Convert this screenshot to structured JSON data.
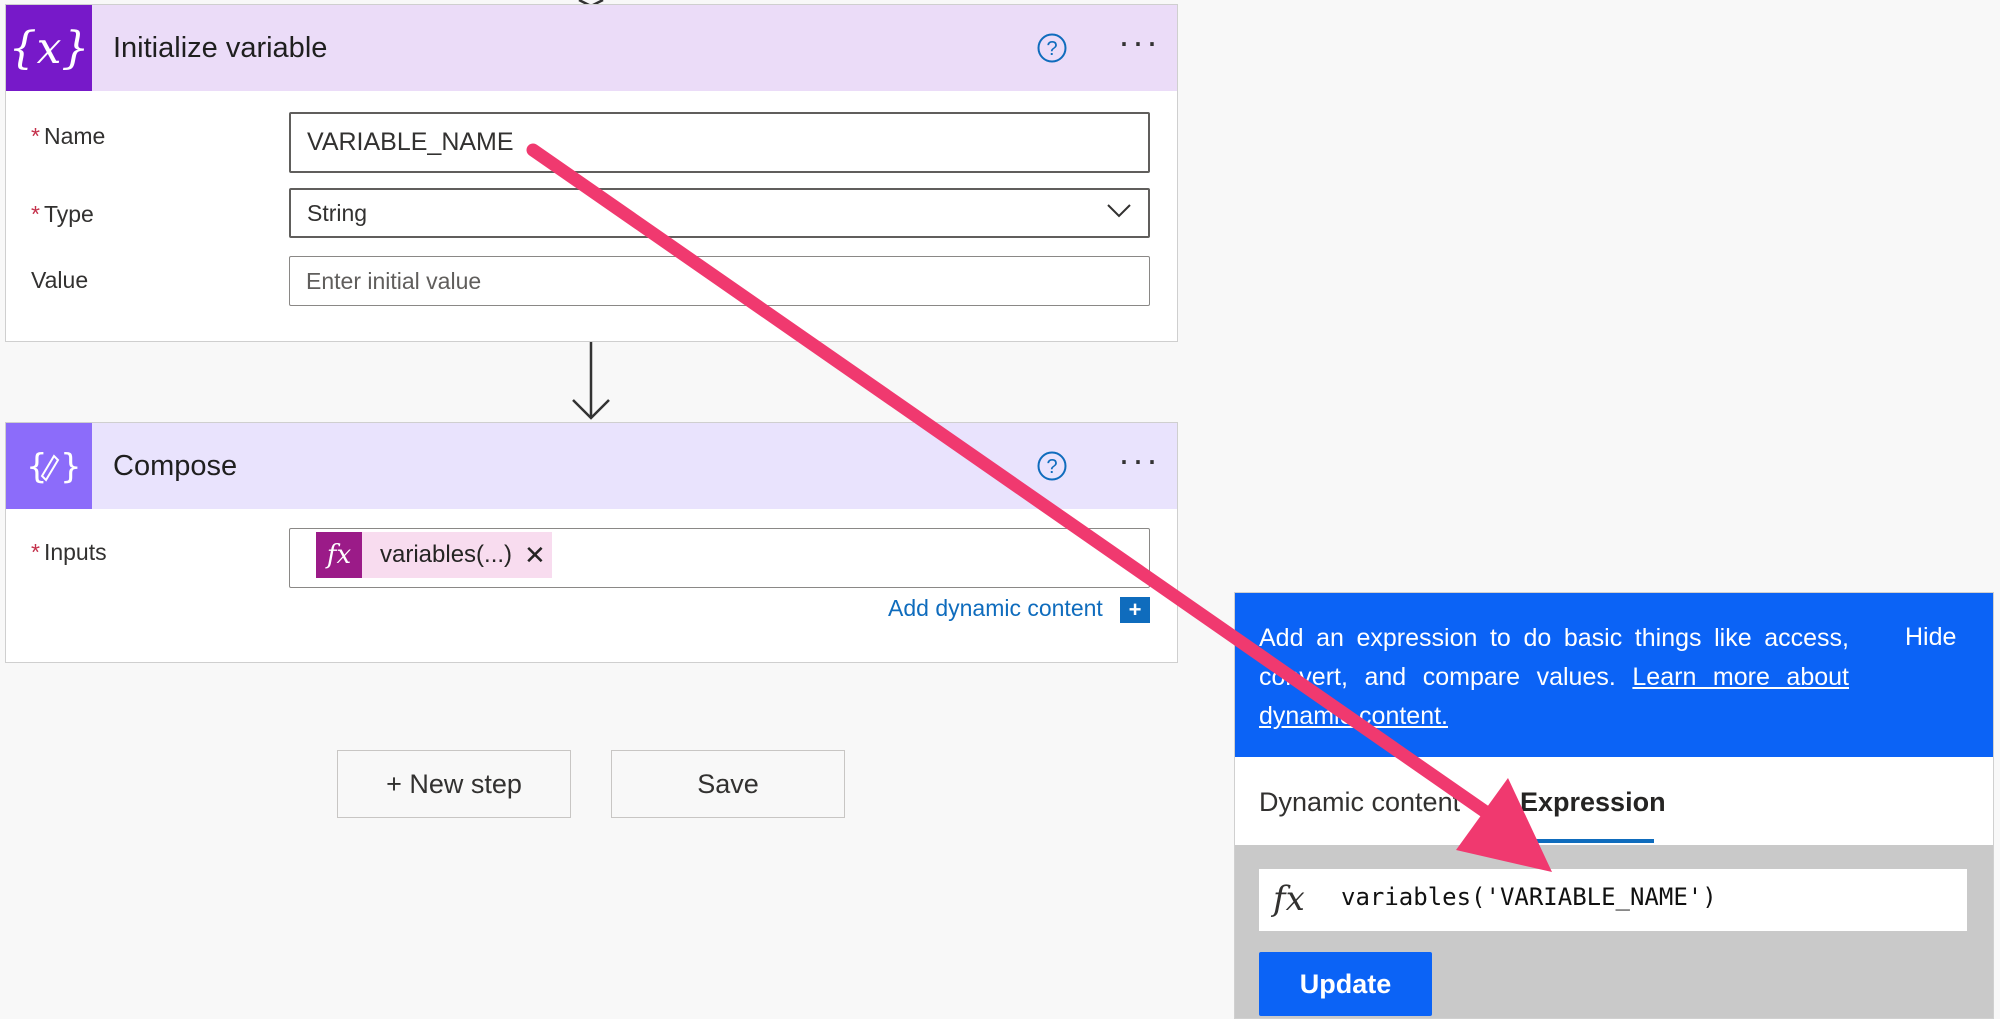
{
  "init_variable": {
    "title": "Initialize variable",
    "name_label": "Name",
    "name_value": "VARIABLE_NAME",
    "type_label": "Type",
    "type_value": "String",
    "value_label": "Value",
    "value_placeholder": "Enter initial value",
    "required_mark": "*"
  },
  "compose": {
    "title": "Compose",
    "inputs_label": "Inputs",
    "token_text": "variables(...)",
    "token_close": "✕",
    "add_dynamic_content": "Add dynamic content",
    "add_dynamic_plus": "+",
    "required_mark": "*"
  },
  "actions": {
    "new_step": "+ New step",
    "save": "Save"
  },
  "panel": {
    "description": "Add an expression to do basic things like access, convert, and compare values.",
    "learn_more": "Learn more about dynamic content.",
    "hide": "Hide",
    "tabs": [
      "Dynamic content",
      "Expression"
    ],
    "active_tab": "Expression",
    "expression_value": "variables('VARIABLE_NAME')",
    "fx_label": "fx",
    "update": "Update"
  },
  "colors": {
    "init_variable_accent": "#7719c9",
    "init_variable_header": "#ebdcf8",
    "compose_accent": "#8c6cfa",
    "compose_header": "#e9e3fd",
    "annotation_arrow": "#f0396f",
    "panel_blue": "#0b63f6"
  }
}
